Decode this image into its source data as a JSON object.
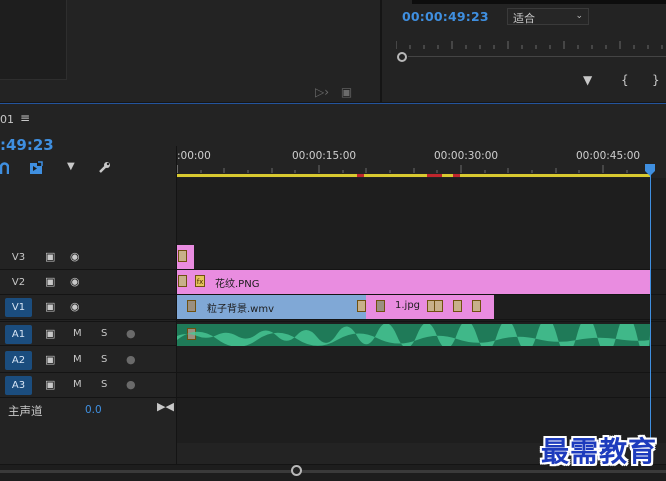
{
  "program_monitor": {
    "timecode": "00:00:49:23",
    "fit": "适合"
  },
  "timeline": {
    "sequence_name_fragment": "01",
    "timecode": ":49:23",
    "ruler_labels": [
      ":00:00",
      "00:00:15:00",
      "00:00:30:00",
      "00:00:45:00"
    ],
    "tracks": {
      "v3": "V3",
      "v2": "V2",
      "v1": "V1",
      "a1": "A1",
      "a2": "A2",
      "a3": "A3"
    },
    "mute_label": "M",
    "solo_label": "S",
    "master": {
      "label": "主声道",
      "value": "0.0"
    },
    "clips": {
      "v2_main": "花纹.PNG",
      "v1_main": "粒子背景.wmv",
      "v1_second": "1.jpg"
    }
  },
  "watermark": "最需教育",
  "colors": {
    "accent_blue": "#3f8fe0",
    "clip_pink": "#e98ce0",
    "clip_blue": "#80a8d6",
    "audio_green": "#2e8a64",
    "workarea_yellow": "#d8c930"
  }
}
